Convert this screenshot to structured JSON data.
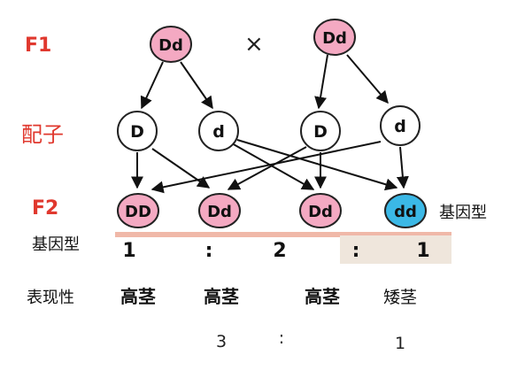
{
  "rows": {
    "f1": "F1",
    "gametes": "配子",
    "f2": "F2",
    "genotype": "基因型",
    "phenotype": "表现性"
  },
  "cross_symbol": "×",
  "parents": [
    {
      "genotype": "Dd",
      "fill": "#f4a9c2"
    },
    {
      "genotype": "Dd",
      "fill": "#f4a9c2"
    }
  ],
  "gametes": [
    {
      "allele": "D"
    },
    {
      "allele": "d"
    },
    {
      "allele": "D"
    },
    {
      "allele": "d"
    }
  ],
  "offspring": [
    {
      "genotype": "DD",
      "fill": "#f4a9c2"
    },
    {
      "genotype": "Dd",
      "fill": "#f4a9c2"
    },
    {
      "genotype": "Dd",
      "fill": "#f4a9c2"
    },
    {
      "genotype": "dd",
      "fill": "#3bb8e6"
    }
  ],
  "offspring_side_label": "基因型",
  "genotype_ratio": [
    "1",
    ":",
    "2",
    ":",
    "1"
  ],
  "phenotypes": [
    "高茎",
    "高茎",
    "高茎",
    "矮茎"
  ],
  "phenotype_ratio": [
    "3",
    ":",
    "1"
  ],
  "colors": {
    "row_label_red": "#e0382e",
    "circle_stroke": "#222222",
    "arrow": "#111111",
    "highlight_bar": "#f0b8a8"
  }
}
